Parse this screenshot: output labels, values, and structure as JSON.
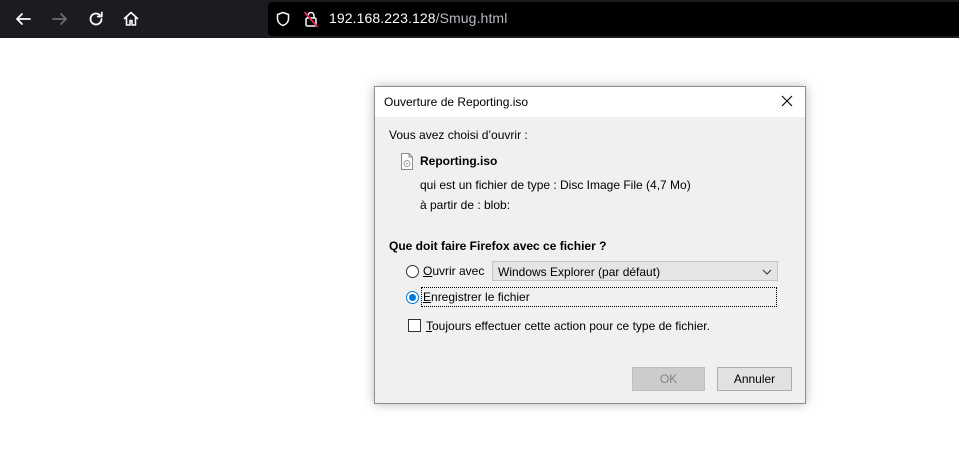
{
  "browser": {
    "url_host": "192.168.223.128",
    "url_path": "/Smug.html",
    "icons": [
      "back-arrow-icon",
      "forward-arrow-icon",
      "reload-icon",
      "home-icon",
      "shield-icon",
      "insecure-lock-icon"
    ]
  },
  "dialog": {
    "title": "Ouverture de Reporting.iso",
    "intro": "Vous avez choisi d’ouvrir :",
    "file_name": "Reporting.iso",
    "type_label": "qui est un fichier de type :",
    "type_value": "Disc Image File (4,7 Mo)",
    "source_label": "à partir de :",
    "source_value": "blob:",
    "question": "Que doit faire Firefox avec ce fichier ?",
    "open_with": {
      "accesskey": "O",
      "label_rest": "uvrir avec",
      "selected": false,
      "app": "Windows Explorer (par défaut)"
    },
    "save_file": {
      "accesskey": "E",
      "label_rest": "nregistrer le fichier",
      "selected": true
    },
    "always": {
      "accesskey": "T",
      "label_rest": "oujours effectuer cette action pour ce type de fichier.",
      "checked": false
    },
    "ok_label": "OK",
    "ok_enabled": false,
    "cancel_label": "Annuler"
  },
  "colors": {
    "toolbar": "#1c1b22",
    "urlbar": "#000000",
    "accent": "#0078d7",
    "insecure": "#e22850"
  }
}
